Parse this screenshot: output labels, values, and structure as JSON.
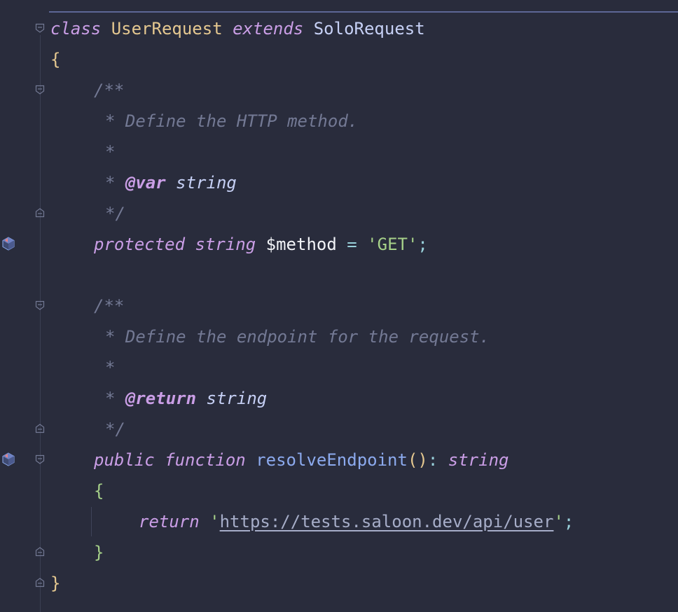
{
  "editor": {
    "lines": {
      "class_decl": {
        "kw_class": "class",
        "class_name": "UserRequest",
        "kw_extends": "extends",
        "parent_class": "SoloRequest"
      },
      "open_brace": "{",
      "doc1_open": "/**",
      "doc1_text": "* Define the HTTP method.",
      "doc1_blank": "*",
      "doc1_tag": {
        "star": "* ",
        "tag": "@var",
        "type": "string"
      },
      "doc1_close": "*/",
      "property": {
        "kw_visibility": "protected",
        "kw_type": "string",
        "variable": "$method",
        "operator": "=",
        "value": "'GET'",
        "semicolon": ";"
      },
      "doc2_open": "/**",
      "doc2_text": "* Define the endpoint for the request.",
      "doc2_blank": "*",
      "doc2_tag": {
        "star": "* ",
        "tag": "@return",
        "type": "string"
      },
      "doc2_close": "*/",
      "method": {
        "kw_visibility": "public",
        "kw_function": "function",
        "name": "resolveEndpoint",
        "parens": "()",
        "colon": ":",
        "return_type": "string"
      },
      "method_open": "{",
      "return_stmt": {
        "kw_return": "return",
        "quote_open": "'",
        "url": "https://tests.saloon.dev/api/user",
        "quote_close": "'",
        "semicolon": ";"
      },
      "method_close": "}",
      "close_brace": "}"
    },
    "gutter_icons": {
      "property": "override-method-icon",
      "method": "override-method-icon"
    },
    "colors": {
      "background": "#292c3c",
      "keyword": "#ca9ee6",
      "class": "#e5c890",
      "string": "#a6d189",
      "comment": "#737994",
      "function": "#8caaee"
    }
  }
}
